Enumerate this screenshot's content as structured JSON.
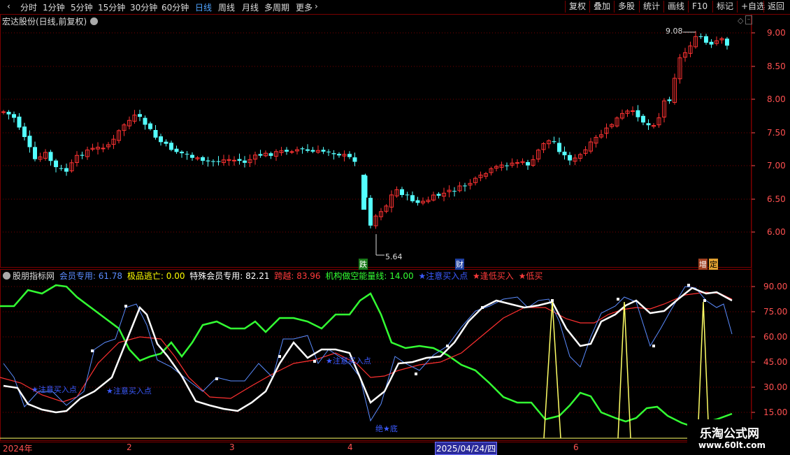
{
  "toolbar": {
    "periods": [
      "分时",
      "1分钟",
      "5分钟",
      "15分钟",
      "30分钟",
      "60分钟",
      "日线",
      "周线",
      "月线",
      "多周期",
      "更多"
    ],
    "active_period": "日线",
    "right_buttons": [
      "复权",
      "叠加",
      "多股",
      "统计",
      "画线",
      "F10",
      "标记",
      "+自选",
      "返回"
    ]
  },
  "main_chart": {
    "stock_title": "宏达股份(日线,前复权)",
    "y_ticks": [
      "9.00",
      "8.50",
      "8.00",
      "7.50",
      "7.00",
      "6.50",
      "6.00"
    ],
    "high_label": "9.08",
    "low_label": "5.64",
    "markers": [
      "跌",
      "财",
      "增",
      "定"
    ]
  },
  "indicator": {
    "name": "股朋指标网",
    "legend": [
      {
        "label": "会员专用: 61.78",
        "color": "#5b8cff"
      },
      {
        "label": "极品逃亡: 0.00",
        "color": "#ffff00"
      },
      {
        "label": "特殊会员专用: 82.21",
        "color": "#ffffff"
      },
      {
        "label": "跨越: 83.96",
        "color": "#ff3b3b"
      },
      {
        "label": "机构做空能量线: 14.00",
        "color": "#33ff33"
      },
      {
        "label": "★注意买入点",
        "color": "#3b5bff"
      },
      {
        "label": "★逢低买入",
        "color": "#ff3b3b"
      },
      {
        "label": "★低买",
        "color": "#ff3b3b"
      }
    ],
    "y_ticks": [
      "90.00",
      "75.00",
      "60.00",
      "45.00",
      "30.00",
      "15.00"
    ],
    "annotations": [
      "★注意买入点",
      "★注意买入点",
      "★注意买入点",
      "绝★底"
    ]
  },
  "date_axis": {
    "labels": [
      "2024年",
      "2",
      "3",
      "4",
      "5",
      "6"
    ],
    "cursor_date": "2025/04/24/四"
  },
  "watermark": {
    "title": "乐淘公式网",
    "url": "www.60lt.com"
  },
  "colors": {
    "up": "#ff3232",
    "down": "#54ffff",
    "grid": "#7a0000",
    "ma_blue": "#5b8cff",
    "white_line": "#ffffff",
    "green_line": "#33ff33",
    "yellow_line": "#ffff66"
  }
}
